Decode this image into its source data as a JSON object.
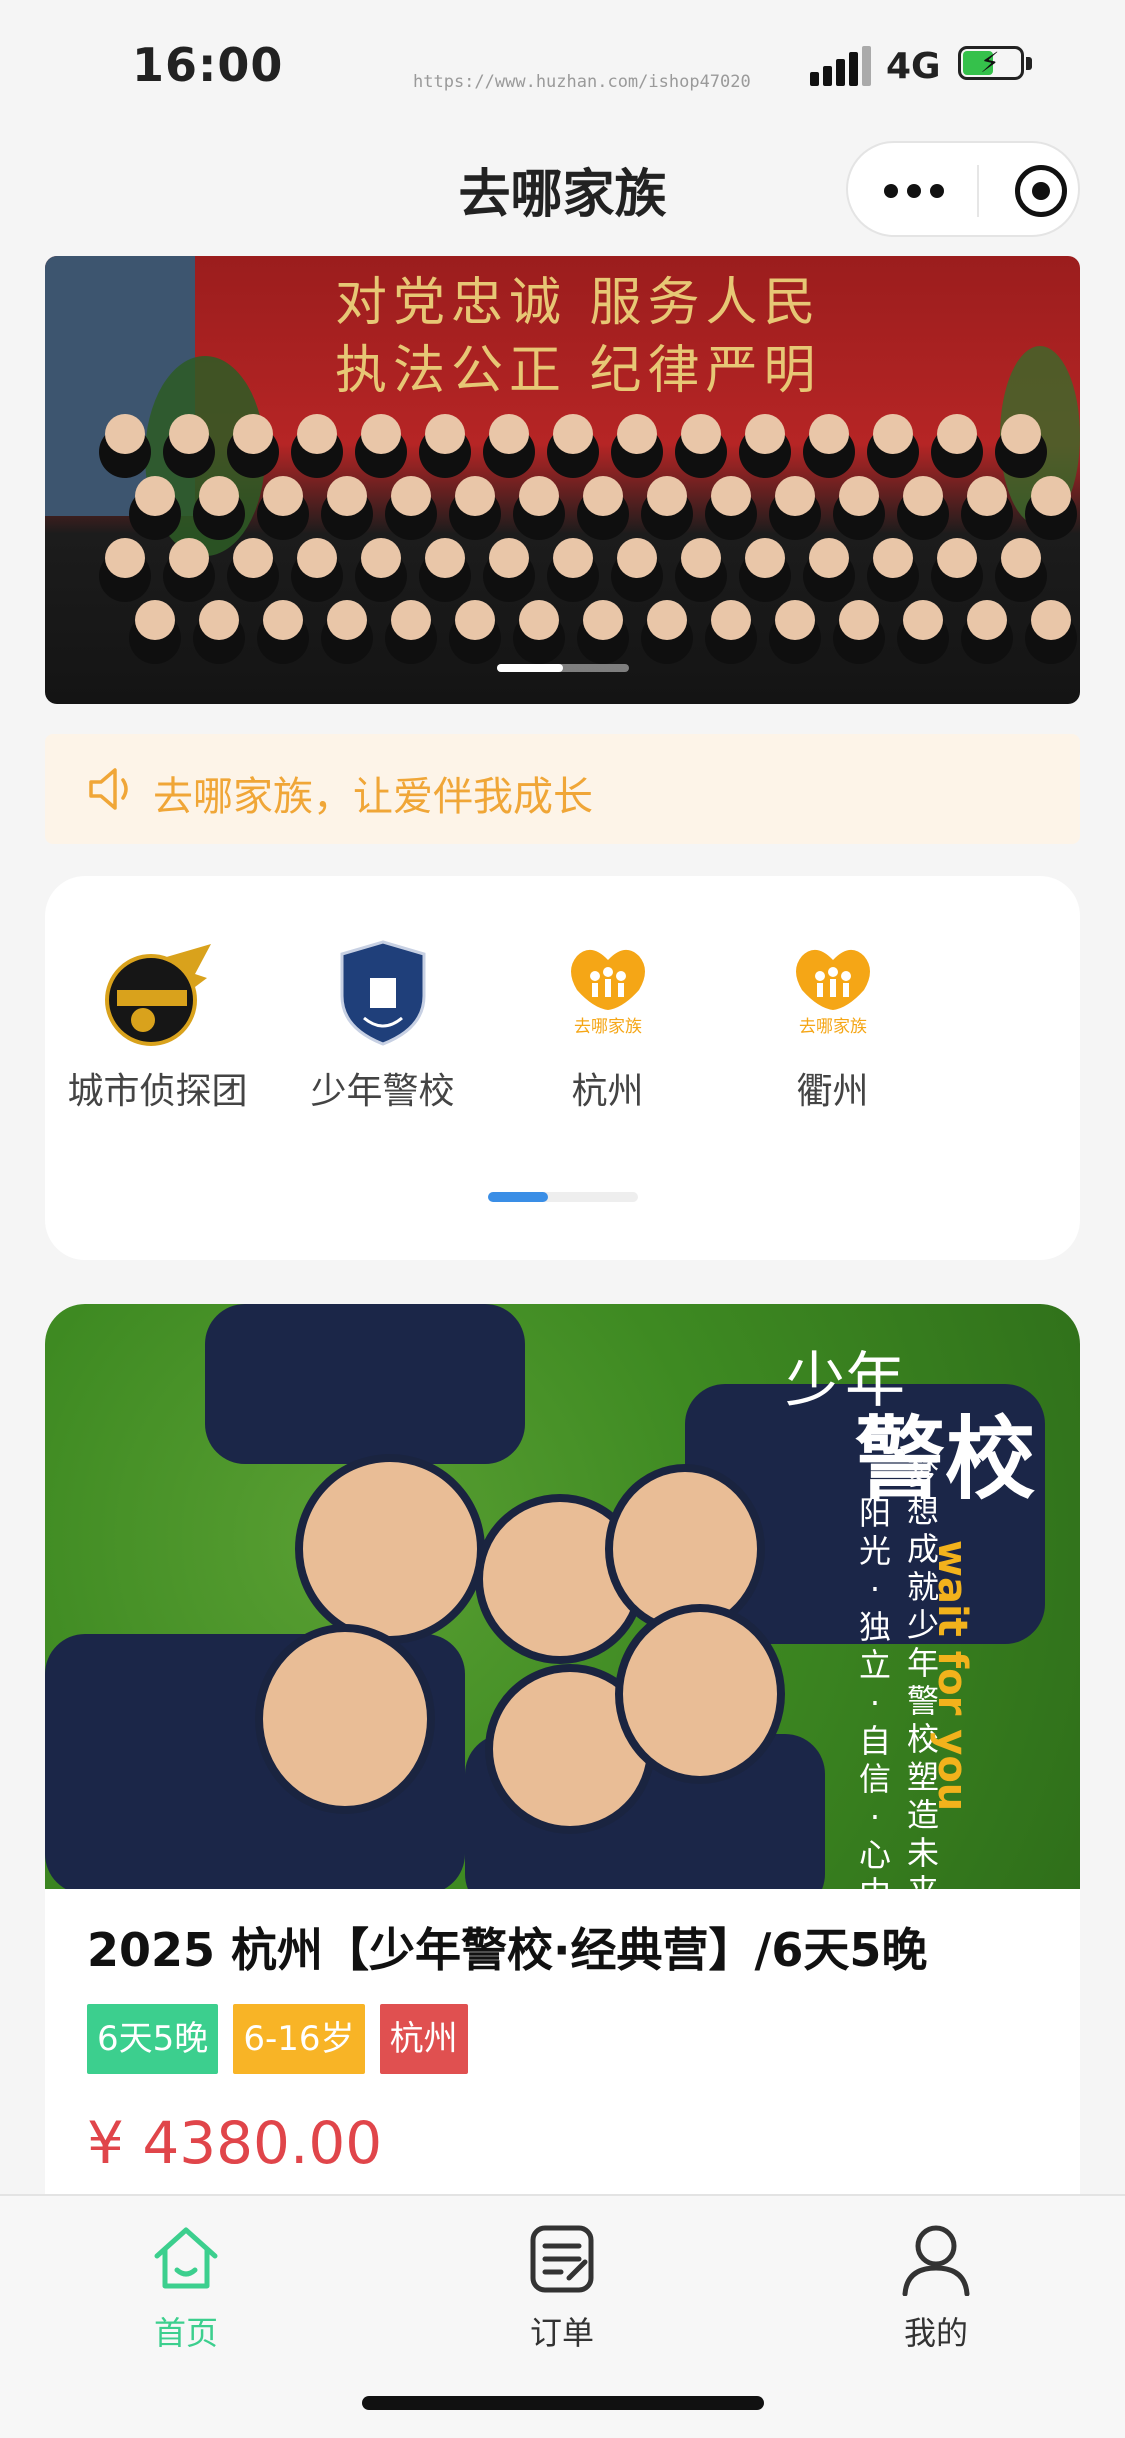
{
  "status_bar": {
    "time": "16:00",
    "watermark": "https://www.huzhan.com/ishop47020",
    "network": "4G",
    "signal_icon": "signal-icon",
    "battery_icon": "battery-charging-icon"
  },
  "nav": {
    "title": "去哪家族",
    "more_icon": "more-dots-icon",
    "close_icon": "target-circle-icon"
  },
  "banner": {
    "slogan_line1": "对党忠诚  服务人民",
    "slogan_line2": "执法公正  纪律严明",
    "slides_count": 2,
    "active_slide": 1
  },
  "notice": {
    "icon": "speaker-icon",
    "text": "去哪家族，让爱伴我成长"
  },
  "categories": [
    {
      "label": "城市侦探团",
      "icon": "detective-team-logo",
      "logo_text": "城市侦探团"
    },
    {
      "label": "少年警校",
      "icon": "police-school-badge",
      "logo_text": "少年警校"
    },
    {
      "label": "杭州",
      "icon": "quna-family-logo",
      "logo_text": "去哪家族"
    },
    {
      "label": "衢州",
      "icon": "quna-family-logo",
      "logo_text": "去哪家族"
    }
  ],
  "product": {
    "poster_small": "少年",
    "poster_big": "警校",
    "poster_vertical_1": "阳光·独立·自信·心中有爱",
    "poster_vertical_2": "梦想成就少年 警校塑造未来",
    "poster_en": "wait for you",
    "title": "2025 杭州【少年警校·经典营】/6天5晚",
    "tags": [
      {
        "label": "6天5晚",
        "color": "#3ccf8e"
      },
      {
        "label": "6-16岁",
        "color": "#f8b426"
      },
      {
        "label": "杭州",
        "color": "#e05050"
      }
    ],
    "price": "¥ 4380.00"
  },
  "tabbar": [
    {
      "label": "首页",
      "icon": "home-icon",
      "active": true,
      "color": "#3ccf8e"
    },
    {
      "label": "订单",
      "icon": "order-icon",
      "active": false,
      "color": "#333333"
    },
    {
      "label": "我的",
      "icon": "user-icon",
      "active": false,
      "color": "#333333"
    }
  ],
  "colors": {
    "accent": "#3ccf8e",
    "notice_text": "#f0a637",
    "price": "#e0454a",
    "scroll_indicator": "#3a8ee6"
  }
}
